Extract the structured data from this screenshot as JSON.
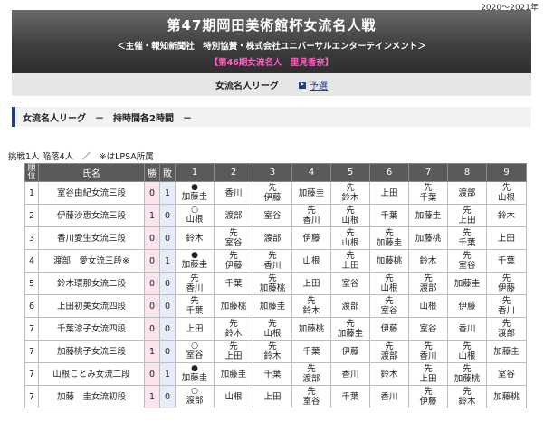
{
  "season": "2020～2021年",
  "banner": {
    "title": "第47期岡田美術館杯女流名人戦",
    "sponsors": "＜主催・報知新聞社　特別協賛・株式会社ユニバーサルエンターテインメント＞",
    "titleholder": "【第46期女流名人　里見香奈】"
  },
  "subnav": {
    "league": "女流名人リーグ",
    "prelim": "予選"
  },
  "section": {
    "title": "女流名人リーグ　－　持時間各2時間　－"
  },
  "note": "挑戦1人 陥落4人　／　※はLPSA所属",
  "colors": {
    "header_bg": "#5a5a5a",
    "win_bg": "#fce4ec",
    "loss_bg": "#e6ecfa",
    "accent": "#1e3f8a",
    "holder": "#ff5fbf"
  },
  "table": {
    "headers": {
      "rank": "順位",
      "name": "氏名",
      "wins": "勝",
      "losses": "敗",
      "rounds": [
        "1",
        "2",
        "3",
        "4",
        "5",
        "6",
        "7",
        "8",
        "9"
      ]
    },
    "rows": [
      {
        "rank": "1",
        "name": "室谷由紀女流三段",
        "wins": "0",
        "losses": "1",
        "cells": [
          {
            "result": "loss",
            "text": "加藤圭"
          },
          {
            "text": "香川"
          },
          {
            "first": true,
            "text": "伊藤"
          },
          {
            "text": "加藤圭"
          },
          {
            "first": true,
            "text": "鈴木"
          },
          {
            "text": "上田"
          },
          {
            "first": true,
            "text": "千葉"
          },
          {
            "text": "渡部"
          },
          {
            "first": true,
            "text": "山根"
          }
        ]
      },
      {
        "rank": "2",
        "name": "伊藤沙恵女流三段",
        "wins": "1",
        "losses": "0",
        "cells": [
          {
            "result": "win",
            "text": "山根"
          },
          {
            "text": "渡部"
          },
          {
            "text": "室谷"
          },
          {
            "first": true,
            "text": "香川"
          },
          {
            "first": true,
            "text": "山根"
          },
          {
            "text": "千葉"
          },
          {
            "text": "加藤圭"
          },
          {
            "first": true,
            "text": "上田"
          },
          {
            "text": "鈴木"
          }
        ]
      },
      {
        "rank": "3",
        "name": "香川愛生女流三段",
        "wins": "0",
        "losses": "0",
        "cells": [
          {
            "text": "鈴木"
          },
          {
            "first": true,
            "text": "室谷"
          },
          {
            "text": "渡部"
          },
          {
            "text": "伊藤"
          },
          {
            "first": true,
            "text": "山根"
          },
          {
            "first": true,
            "text": "加藤圭"
          },
          {
            "text": "加藤桃"
          },
          {
            "first": true,
            "text": "千葉"
          },
          {
            "text": "上田"
          }
        ]
      },
      {
        "rank": "4",
        "name": "渡部　愛女流三段※",
        "wins": "0",
        "losses": "1",
        "cells": [
          {
            "result": "loss",
            "text": "加藤圭"
          },
          {
            "first": true,
            "text": "伊藤"
          },
          {
            "first": true,
            "text": "香川"
          },
          {
            "text": "山根"
          },
          {
            "first": true,
            "text": "上田"
          },
          {
            "text": "加藤桃"
          },
          {
            "text": "鈴木"
          },
          {
            "first": true,
            "text": "室谷"
          },
          {
            "text": "千葉"
          }
        ]
      },
      {
        "rank": "5",
        "name": "鈴木環那女流二段",
        "wins": "0",
        "losses": "0",
        "cells": [
          {
            "first": true,
            "text": "香川"
          },
          {
            "text": "千葉"
          },
          {
            "first": true,
            "text": "加藤桃"
          },
          {
            "text": "上田"
          },
          {
            "text": "室谷"
          },
          {
            "first": true,
            "text": "山根"
          },
          {
            "first": true,
            "text": "渡部"
          },
          {
            "text": "加藤圭"
          },
          {
            "first": true,
            "text": "伊藤"
          }
        ]
      },
      {
        "rank": "6",
        "name": "上田初美女流四段",
        "wins": "0",
        "losses": "0",
        "cells": [
          {
            "first": true,
            "text": "千葉"
          },
          {
            "text": "加藤桃"
          },
          {
            "text": "加藤圭"
          },
          {
            "first": true,
            "text": "鈴木"
          },
          {
            "text": "渡部"
          },
          {
            "first": true,
            "text": "室谷"
          },
          {
            "text": "山根"
          },
          {
            "text": "伊藤"
          },
          {
            "first": true,
            "text": "香川"
          }
        ]
      },
      {
        "rank": "7",
        "name": "千葉涼子女流四段",
        "wins": "0",
        "losses": "0",
        "cells": [
          {
            "text": "上田"
          },
          {
            "first": true,
            "text": "鈴木"
          },
          {
            "first": true,
            "text": "山根"
          },
          {
            "text": "加藤桃"
          },
          {
            "first": true,
            "text": "加藤圭"
          },
          {
            "text": "伊藤"
          },
          {
            "text": "室谷"
          },
          {
            "text": "香川"
          },
          {
            "first": true,
            "text": "渡部"
          }
        ]
      },
      {
        "rank": "7",
        "name": "加藤桃子女流三段",
        "wins": "1",
        "losses": "0",
        "cells": [
          {
            "result": "win",
            "text": "室谷"
          },
          {
            "first": true,
            "text": "上田"
          },
          {
            "first": true,
            "text": "鈴木"
          },
          {
            "text": "千葉"
          },
          {
            "text": "伊藤"
          },
          {
            "first": true,
            "text": "渡部"
          },
          {
            "first": true,
            "text": "香川"
          },
          {
            "first": true,
            "text": "山根"
          },
          {
            "text": "加藤圭"
          }
        ]
      },
      {
        "rank": "7",
        "name": "山根ことみ女流二段",
        "wins": "0",
        "losses": "1",
        "cells": [
          {
            "result": "loss",
            "text": "加藤圭"
          },
          {
            "text": "加藤圭"
          },
          {
            "text": "千葉"
          },
          {
            "first": true,
            "text": "渡部"
          },
          {
            "text": "香川"
          },
          {
            "text": "鈴木"
          },
          {
            "first": true,
            "text": "上田"
          },
          {
            "first": true,
            "text": "加藤桃"
          },
          {
            "text": "室谷"
          }
        ]
      },
      {
        "rank": "7",
        "name": "加藤　圭女流初段",
        "wins": "1",
        "losses": "0",
        "cells": [
          {
            "result": "win",
            "text": "渡部"
          },
          {
            "text": "山根"
          },
          {
            "text": "上田"
          },
          {
            "first": true,
            "text": "室谷"
          },
          {
            "text": "千葉"
          },
          {
            "text": "香川"
          },
          {
            "first": true,
            "text": "伊藤"
          },
          {
            "first": true,
            "text": "鈴木"
          },
          {
            "text": "加藤桃"
          }
        ]
      }
    ],
    "first_mark": "先"
  }
}
